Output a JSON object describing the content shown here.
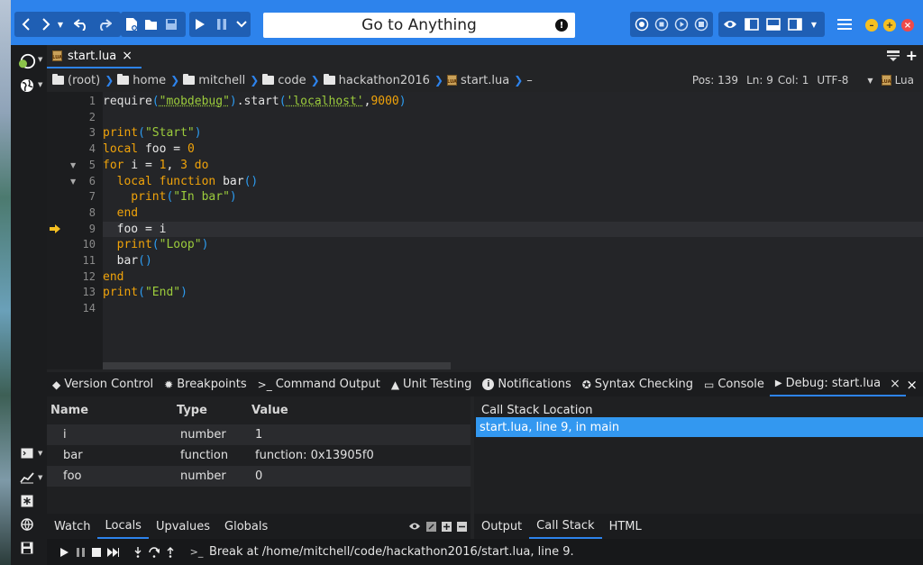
{
  "toolbar": {
    "goto_placeholder": "Go to Anything",
    "goto_alert": "!"
  },
  "editor_tab": {
    "label": "start.lua",
    "close": "×"
  },
  "breadcrumb": [
    {
      "label": "(root)"
    },
    {
      "label": "home"
    },
    {
      "label": "mitchell"
    },
    {
      "label": "code"
    },
    {
      "label": "hackathon2016"
    },
    {
      "label": "start.lua",
      "file": true
    }
  ],
  "breadcrumb_tail": "–",
  "status": {
    "pos": "Pos: 139",
    "ln": "Ln: 9",
    "col": "Col: 1",
    "encoding": "UTF-8",
    "language": "Lua"
  },
  "code": {
    "current_line": 9,
    "lines": [
      {
        "n": "1"
      },
      {
        "n": "2"
      },
      {
        "n": "3"
      },
      {
        "n": "4"
      },
      {
        "n": "5"
      },
      {
        "n": "6"
      },
      {
        "n": "7"
      },
      {
        "n": "8"
      },
      {
        "n": "9"
      },
      {
        "n": "10"
      },
      {
        "n": "11"
      },
      {
        "n": "12"
      },
      {
        "n": "13"
      },
      {
        "n": "14"
      }
    ],
    "tokens": {
      "l1a": "require",
      "l1b": "(",
      "l1c": "\"mobdebug\"",
      "l1d": ")",
      "l1e": ".start",
      "l1f": "(",
      "l1g": "'localhost'",
      "l1h": ",",
      "l1i": "9000",
      "l1j": ")",
      "l3a": "print",
      "l3b": "(",
      "l3c": "\"Start\"",
      "l3d": ")",
      "l4a": "local",
      "l4b": " foo = ",
      "l4c": "0",
      "l5a": "for",
      "l5b": " i = ",
      "l5c": "1",
      "l5d": ", ",
      "l5e": "3",
      "l5f": " ",
      "l5g": "do",
      "l6a": "  local",
      "l6b": " ",
      "l6c": "function",
      "l6d": " bar",
      "l6e": "()",
      "l7a": "    print",
      "l7b": "(",
      "l7c": "\"In bar\"",
      "l7d": ")",
      "l8a": "  end",
      "l9a": "  foo = i",
      "l10a": "  print",
      "l10b": "(",
      "l10c": "\"Loop\"",
      "l10d": ")",
      "l11a": "  bar",
      "l11b": "()",
      "l12a": "end",
      "l13a": "print",
      "l13b": "(",
      "l13c": "\"End\"",
      "l13d": ")"
    }
  },
  "panel_tabs": [
    {
      "label": "Version Control"
    },
    {
      "label": "Breakpoints"
    },
    {
      "label": "Command Output"
    },
    {
      "label": "Unit Testing"
    },
    {
      "label": "Notifications"
    },
    {
      "label": "Syntax Checking"
    },
    {
      "label": "Console"
    },
    {
      "label": "Debug: start.lua",
      "active": true
    }
  ],
  "panel_tabs_icons": {
    "vc": "◆",
    "bp": "✹",
    "cmd": ">_",
    "unit": "▲",
    "notif": "i",
    "syntax": "✪",
    "console": "▭",
    "debug": "▶",
    "close": "×"
  },
  "variables": {
    "headers": {
      "name": "Name",
      "type": "Type",
      "value": "Value"
    },
    "rows": [
      {
        "name": "i",
        "type": "number",
        "value": "1"
      },
      {
        "name": "bar",
        "type": "function",
        "value": "function: 0x13905f0"
      },
      {
        "name": "foo",
        "type": "number",
        "value": "0"
      }
    ]
  },
  "call_stack": {
    "header": "Call Stack Location",
    "rows": [
      {
        "label": "start.lua, line 9, in main"
      }
    ]
  },
  "left_subtabs": [
    {
      "label": "Watch"
    },
    {
      "label": "Locals",
      "active": true
    },
    {
      "label": "Upvalues"
    },
    {
      "label": "Globals"
    }
  ],
  "right_subtabs": [
    {
      "label": "Output"
    },
    {
      "label": "Call Stack",
      "active": true
    },
    {
      "label": "HTML"
    }
  ],
  "debug_status": "Break at /home/mitchell/code/hackathon2016/start.lua, line 9.",
  "debug_prompt": ">_",
  "colors": {
    "accent": "#2d83ec",
    "keyword": "#f0a30a",
    "string": "#9ccc3c",
    "paren": "#2d9cf0",
    "selection": "#3398f0"
  }
}
